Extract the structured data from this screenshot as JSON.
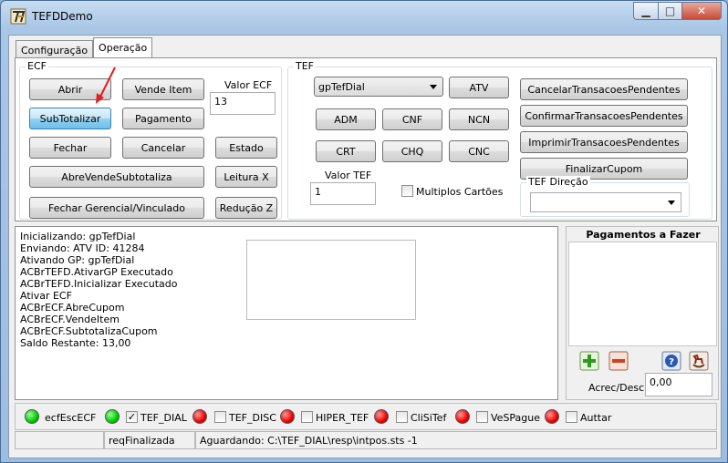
{
  "window": {
    "title": "TEFDDemo",
    "controls": {
      "minimize": "▁",
      "maximize": "□",
      "close": "✕"
    }
  },
  "tabs": [
    {
      "label": "Configuração",
      "active": false
    },
    {
      "label": "Operação",
      "active": true
    }
  ],
  "ecf": {
    "group_label": "ECF",
    "buttons": {
      "abrir": "Abrir",
      "vende_item": "Vende Item",
      "subtotalizar": "SubTotalizar",
      "pagamento": "Pagamento",
      "fechar": "Fechar",
      "cancelar": "Cancelar",
      "estado": "Estado",
      "abre_vende_subtotaliza": "AbreVendeSubtotaliza",
      "leitura_x": "Leitura X",
      "fechar_gerencial": "Fechar Gerencial/Vinculado",
      "reducao_z": "Redução Z"
    },
    "valor_label": "Valor ECF",
    "valor_value": "13"
  },
  "tef": {
    "group_label": "TEF",
    "gp_select": "gpTefDial",
    "buttons": {
      "atv": "ATV",
      "adm": "ADM",
      "cnf": "CNF",
      "ncn": "NCN",
      "crt": "CRT",
      "chq": "CHQ",
      "cnc": "CNC",
      "cancelar_pend": "CancelarTransacoesPendentes",
      "confirmar_pend": "ConfirmarTransacoesPendentes",
      "imprimir_pend": "ImprimirTransacoesPendentes",
      "finalizar_cupom": "FinalizarCupom"
    },
    "valor_label": "Valor TEF",
    "valor_value": "1",
    "multiplos_label": "Multiplos Cartões",
    "direcao_label": "TEF Direção",
    "direcao_value": ""
  },
  "log": {
    "lines": [
      "Inicializando: gpTefDial",
      "Enviando: ATV ID: 41284",
      "Ativando GP: gpTefDial",
      "ACBrTEFD.AtivarGP Executado",
      "ACBrTEFD.Inicializar Executado",
      "Ativar ECF",
      "ACBrECF.AbreCupom",
      "ACBrECF.VendeItem",
      "ACBrECF.SubtotalizaCupom",
      "Saldo Restante: 13,00"
    ]
  },
  "payments": {
    "title": "Pagamentos a Fazer",
    "acrec_label": "Acrec/Desc",
    "acrec_value": "0,00"
  },
  "status_row": {
    "ecf_label": "ecfEscECF",
    "items": [
      {
        "label": "TEF_DIAL",
        "checked": true,
        "led": "green"
      },
      {
        "label": "TEF_DISC",
        "checked": false,
        "led": "red"
      },
      {
        "label": "HIPER_TEF",
        "checked": false,
        "led": "red"
      },
      {
        "label": "CliSiTef",
        "checked": false,
        "led": "red"
      },
      {
        "label": "VeSPague",
        "checked": false,
        "led": "red"
      },
      {
        "label": "Auttar",
        "checked": false,
        "led": "red"
      }
    ],
    "check_mark": "✓"
  },
  "statusbar": {
    "cell1": "",
    "cell2": "reqFinalizada",
    "cell3": "Aguardando: C:\\TEF_DIAL\\resp\\intpos.sts -1"
  },
  "colors": {
    "led_green": "#00cc00",
    "led_red": "#ee0000",
    "focus_button": "#98d1ef",
    "annotation_arrow": "#e02020"
  }
}
